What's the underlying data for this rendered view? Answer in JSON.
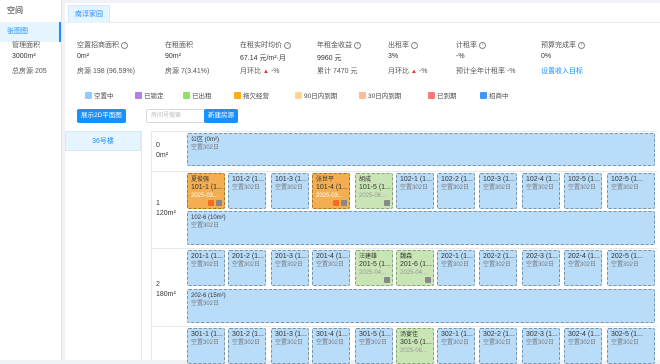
{
  "sidebar": {
    "title": "空间",
    "item": "张图图"
  },
  "tab": "南淳家园",
  "stats": [
    {
      "label": "管理面积",
      "value": "3000m²",
      "sub": "总房源 205"
    },
    {
      "label": "空置招商面积",
      "value": "0m²",
      "sub": "房源 198 (96.59%)"
    },
    {
      "label": "在租面积",
      "value": "90m²",
      "sub": "房源 7(3.41%)"
    },
    {
      "label": "在租实时均价",
      "value": "67.14 元/m²·月",
      "sub": "月环比",
      "sub2": "-%"
    },
    {
      "label": "年租金收益",
      "value": "9960 元",
      "sub": "累计 7470 元"
    },
    {
      "label": "出租率",
      "value": "3%",
      "sub": "月环比",
      "sub2": "-%"
    },
    {
      "label": "计租率",
      "value": "-%",
      "sub": "预计全年计租率 -%"
    },
    {
      "label": "预算完成率",
      "value": "0%",
      "sub": "设置收入目标"
    }
  ],
  "legend": [
    {
      "label": "空置中",
      "color": "#91caff"
    },
    {
      "label": "已锁定",
      "color": "#b37feb"
    },
    {
      "label": "已出租",
      "color": "#95de64"
    },
    {
      "label": "拖欠经营",
      "color": "#faad14"
    },
    {
      "label": "90日内到期",
      "color": "#ffd591"
    },
    {
      "label": "30日内到期",
      "color": "#ffbb96"
    },
    {
      "label": "已到期",
      "color": "#ff7875"
    },
    {
      "label": "招商中",
      "color": "#4096ff"
    }
  ],
  "toolbar": {
    "show2d": "展示2D平面图",
    "search_placeholder": "房间号搜索",
    "new_room": "新建房源"
  },
  "building": "36号楼",
  "floors": [
    {
      "num": "0",
      "area": "0m²"
    },
    {
      "num": "1",
      "area": "120m²"
    },
    {
      "num": "2",
      "area": "180m²"
    },
    {
      "num": "3",
      "area": ""
    }
  ],
  "rooms": {
    "public0": {
      "title": "公区 (0m²)",
      "status": "空置302日"
    },
    "r101_1": {
      "tenant": "夏俊强",
      "name": "101-1 (1...",
      "date": "2025-03..."
    },
    "r101_2": {
      "name": "101-2 (1...",
      "status": "空置302日"
    },
    "r101_3": {
      "name": "101-3 (1...",
      "status": "空置302日"
    },
    "r101_4": {
      "tenant": "张世平",
      "name": "101-4 (1...",
      "date": "2025-03..."
    },
    "r101_5": {
      "tenant": "胡成",
      "name": "101-5 (1...",
      "date": "2025-06..."
    },
    "r102_1": {
      "name": "102-1 (1...",
      "status": "空置302日"
    },
    "r102_2": {
      "name": "102-2 (1...",
      "status": "空置302日"
    },
    "r102_3": {
      "name": "102-3 (1...",
      "status": "空置302日"
    },
    "r102_4": {
      "name": "102-4 (1...",
      "status": "空置302日"
    },
    "r102_5": {
      "name": "102-5 (1...",
      "status": "空置302日"
    },
    "r102_6": {
      "name": "102-6 (10m²)",
      "status": "空置302日"
    },
    "r201_1": {
      "name": "201-1 (1...",
      "status": "空置302日"
    },
    "r201_2": {
      "name": "201-2 (1...",
      "status": "空置302日"
    },
    "r201_3": {
      "name": "201-3 (1...",
      "status": "空置302日"
    },
    "r201_4": {
      "name": "201-4 (1...",
      "status": "空置302日"
    },
    "r201_5": {
      "tenant": "汪建雄",
      "name": "201-5 (1...",
      "date": "2025-04..."
    },
    "r201_6": {
      "tenant": "魏森",
      "name": "201-6 (1...",
      "date": "2025-04..."
    },
    "r202_1": {
      "name": "202-1 (1...",
      "status": "空置302日"
    },
    "r202_2": {
      "name": "202-2 (1...",
      "status": "空置302日"
    },
    "r202_3": {
      "name": "202-3 (1...",
      "status": "空置302日"
    },
    "r202_4": {
      "name": "202-4 (1...",
      "status": "空置302日"
    },
    "r202_5": {
      "name": "202-5 (1...",
      "status": "空置302日"
    },
    "r202_6": {
      "name": "202-6 (15m²)",
      "status": "空置302日"
    },
    "r301_1": {
      "name": "301-1 (1...",
      "status": "空置302日"
    },
    "r301_2": {
      "name": "301-2 (1...",
      "status": "空置302日"
    },
    "r301_3": {
      "name": "301-3 (1...",
      "status": "空置302日"
    },
    "r301_4": {
      "name": "301-4 (1...",
      "status": "空置302日"
    },
    "r301_5": {
      "name": "301-5 (1...",
      "status": "空置302日"
    },
    "r301_6": {
      "tenant": "汤宴佳",
      "name": "301-6 (1...",
      "date": "2025-06..."
    },
    "r302_1": {
      "name": "302-1 (1...",
      "status": "空置302日"
    },
    "r302_2": {
      "name": "302-2 (1...",
      "status": "空置302日"
    },
    "r302_3": {
      "name": "302-3 (1...",
      "status": "空置302日"
    },
    "r302_4": {
      "name": "302-4 (1...",
      "status": "空置302日"
    },
    "r302_5": {
      "name": "302-5 (1...",
      "status": "空置302日"
    }
  }
}
